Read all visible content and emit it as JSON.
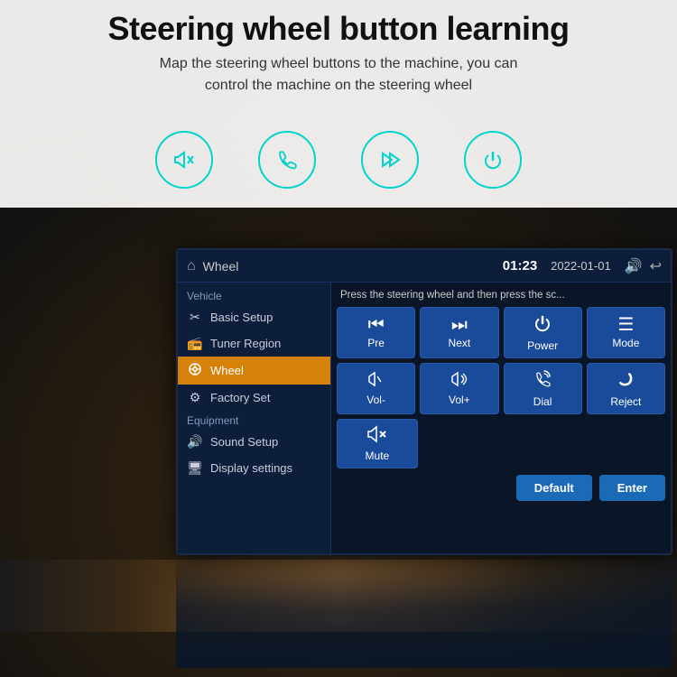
{
  "page": {
    "title": "Steering wheel button learning",
    "subtitle_line1": "Map the steering wheel buttons to the machine, you can",
    "subtitle_line2": "control the machine on the steering wheel"
  },
  "icons": [
    {
      "name": "mute-icon",
      "symbol": "🔇",
      "label": "mute"
    },
    {
      "name": "call-icon",
      "symbol": "📞",
      "label": "call"
    },
    {
      "name": "skip-icon",
      "symbol": "⏭",
      "label": "skip"
    },
    {
      "name": "power-icon",
      "symbol": "⏻",
      "label": "power"
    }
  ],
  "screen": {
    "header": {
      "home_icon": "⌂",
      "wheel_label": "Wheel",
      "time": "01:23",
      "date": "2022-01-01",
      "volume_icon": "🔊",
      "back_icon": "↩"
    },
    "instruction": "Press the steering wheel and then press the sc...",
    "left_menu": {
      "section1_label": "Vehicle",
      "items": [
        {
          "icon": "✂",
          "label": "Basic Setup",
          "active": false
        },
        {
          "icon": "📻",
          "label": "Tuner Region",
          "active": false
        },
        {
          "icon": "🎡",
          "label": "Wheel",
          "active": true
        },
        {
          "icon": "🏭",
          "label": "Factory Set",
          "active": false
        }
      ],
      "section2_label": "Equipment",
      "items2": [
        {
          "icon": "🔊",
          "label": "Sound Setup",
          "active": false
        },
        {
          "icon": "🖥",
          "label": "Display settings",
          "active": false
        }
      ]
    },
    "control_buttons": {
      "row1": [
        {
          "id": "pre-btn",
          "icon": "⏮",
          "label": "Pre"
        },
        {
          "id": "next-btn",
          "icon": "⏭",
          "label": "Next"
        },
        {
          "id": "power-btn",
          "icon": "⏻",
          "label": "Power"
        },
        {
          "id": "mode-btn",
          "icon": "☰",
          "label": "Mode"
        }
      ],
      "row2": [
        {
          "id": "vol-down-btn",
          "icon": "🔉",
          "label": "Vol-"
        },
        {
          "id": "vol-up-btn",
          "icon": "🔊",
          "label": "Vol+"
        },
        {
          "id": "dial-btn",
          "icon": "↩",
          "label": "Dial"
        },
        {
          "id": "reject-btn",
          "icon": "📵",
          "label": "Reject"
        }
      ],
      "row3": [
        {
          "id": "mute-btn",
          "icon": "🔇",
          "label": "Mute"
        }
      ]
    },
    "action_buttons": {
      "default_label": "Default",
      "enter_label": "Enter"
    }
  }
}
